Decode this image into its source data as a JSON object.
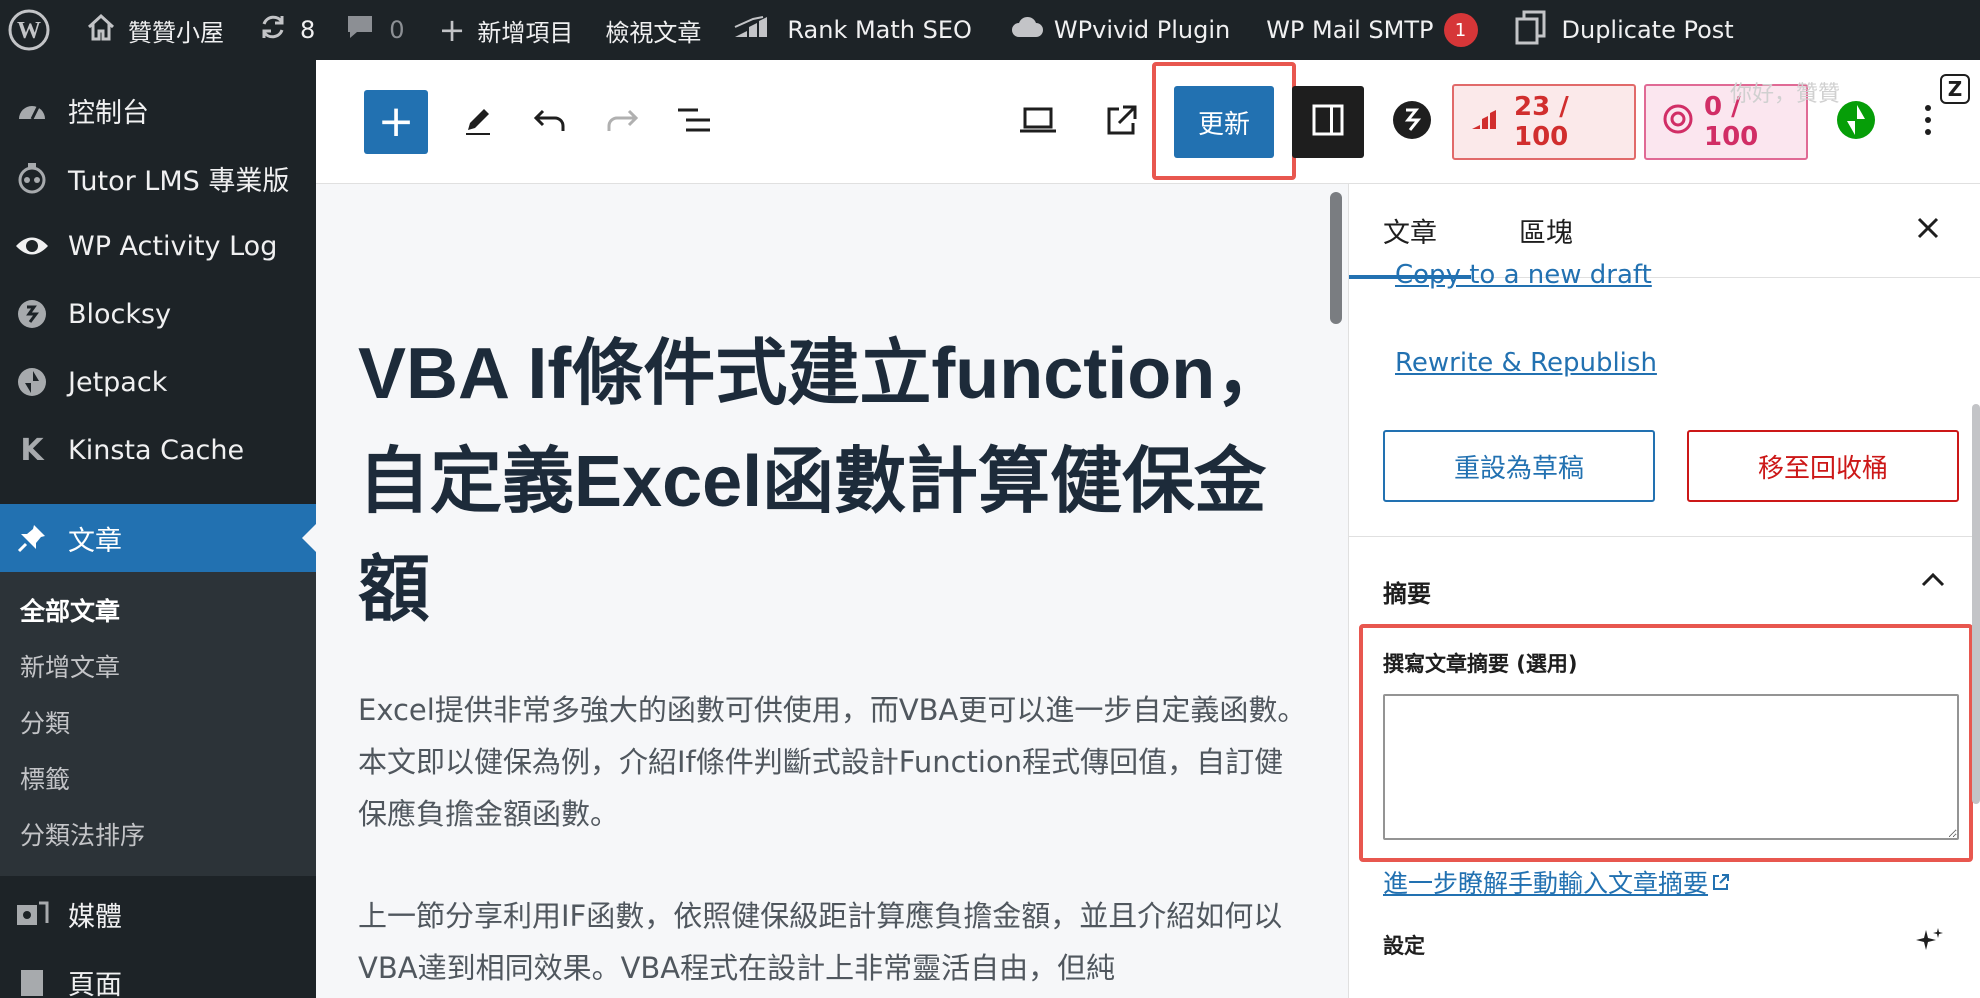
{
  "adminbar": {
    "site_name": "贊贊小屋",
    "updates_count": "8",
    "comments_count": "0",
    "new_item": "新增項目",
    "view_post": "檢視文章",
    "rank_math": "Rank Math SEO",
    "wpvivid": "WPvivid Plugin",
    "wp_mail_smtp": "WP Mail SMTP",
    "smtp_badge": "1",
    "duplicate_post": "Duplicate Post",
    "greeting": "你好，贊贊"
  },
  "sidebar": {
    "items": [
      {
        "label": "控制台",
        "icon": "dashboard-icon"
      },
      {
        "label": "Tutor LMS 專業版",
        "icon": "tutor-icon"
      },
      {
        "label": "WP Activity Log",
        "icon": "eye-icon"
      },
      {
        "label": "Blocksy",
        "icon": "blocksy-icon"
      },
      {
        "label": "Jetpack",
        "icon": "jetpack-icon"
      },
      {
        "label": "Kinsta Cache",
        "icon": "kinsta-icon"
      }
    ],
    "active": {
      "label": "文章",
      "icon": "pin-icon"
    },
    "submenu": [
      "全部文章",
      "新增文章",
      "分類",
      "標籤",
      "分類法排序"
    ],
    "after": [
      {
        "label": "媒體",
        "icon": "media-icon"
      },
      {
        "label": "頁面",
        "icon": "page-icon"
      }
    ]
  },
  "toolbar": {
    "inserter": "+",
    "update_label": "更新",
    "seo_score": "23 / 100",
    "ai_score": "0 / 100"
  },
  "editor": {
    "title": "VBA If條件式建立function，自定義Excel函數計算健保金額",
    "paragraphs": [
      "Excel提供非常多強大的函數可供使用，而VBA更可以進一步自定義函數。本文即以健保為例，介紹If條件判斷式設計Function程式傳回值，自訂健保應負擔金額函數。",
      "上一節分享利用IF函數，依照健保級距計算應負擔金額，並且介紹如何以VBA達到相同效果。VBA程式在設計上非常靈活自由，但純"
    ]
  },
  "panel": {
    "tabs": [
      "文章",
      "區塊"
    ],
    "copy_link": "Copy to a new draft",
    "rewrite_link": "Rewrite & Republish",
    "draft_button": "重設為草稿",
    "trash_button": "移至回收桶",
    "excerpt_section": "摘要",
    "excerpt_label": "撰寫文章摘要 (選用)",
    "excerpt_value": "",
    "learn_more": "進一步瞭解手動輸入文章摘要",
    "settings_section": "設定"
  },
  "colors": {
    "admin_dark": "#1d2327",
    "accent": "#2271b1",
    "highlight": "#e8574f",
    "danger": "#cc1818"
  }
}
